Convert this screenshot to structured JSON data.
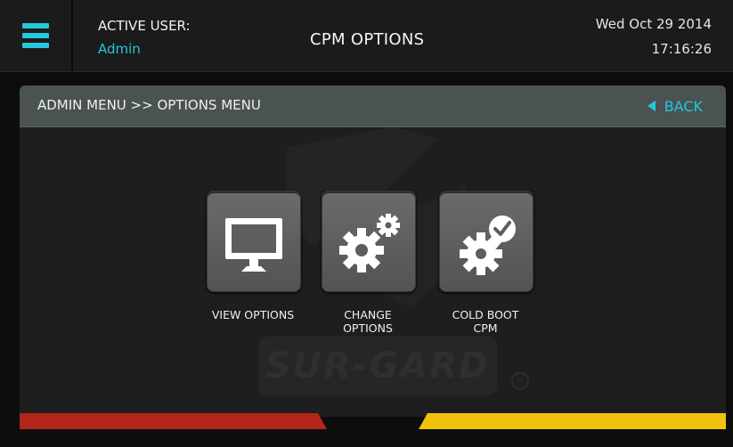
{
  "header": {
    "user_label": "ACTIVE USER:",
    "user_name": "Admin",
    "title": "CPM OPTIONS",
    "date": "Wed Oct 29 2014",
    "time": "17:16:26"
  },
  "panel": {
    "breadcrumb": "ADMIN MENU >> OPTIONS MENU",
    "back_label": "BACK"
  },
  "watermark": {
    "brand": "SUR-GARD",
    "registered": "®"
  },
  "tiles": [
    {
      "label_line1": "VIEW OPTIONS",
      "label_line2": "",
      "icon": "monitor-icon"
    },
    {
      "label_line1": "CHANGE",
      "label_line2": "OPTIONS",
      "icon": "gears-icon"
    },
    {
      "label_line1": "COLD BOOT",
      "label_line2": "CPM",
      "icon": "gears-check-icon"
    }
  ],
  "colors": {
    "accent": "#25c7dd",
    "panel_bar": "#4a5252",
    "stripe_red": "#b3241b",
    "stripe_yellow": "#f0c20c"
  }
}
